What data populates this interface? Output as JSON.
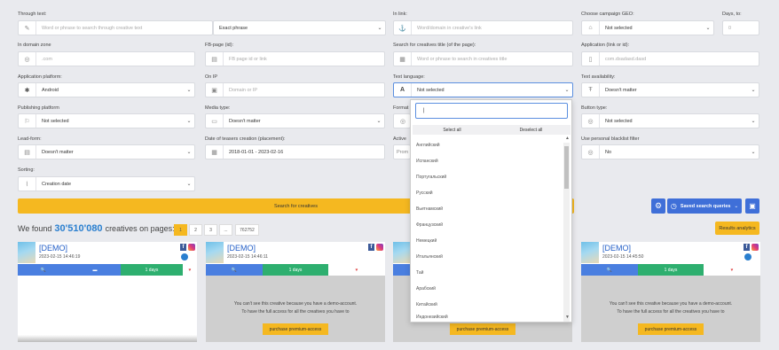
{
  "filters": {
    "through_text": {
      "label": "Through text:",
      "placeholder": "Word or phrase to search through creative text",
      "mode": "Exact phrase"
    },
    "in_link": {
      "label": "In link:",
      "placeholder": "Word/domain in creative's link"
    },
    "campaign_geo": {
      "label": "Choose campaign GEO:",
      "value": "Not selected"
    },
    "days_to": {
      "label": "Days, to:",
      "value": "0"
    },
    "domain_zone": {
      "label": "In domain zone",
      "placeholder": ".com"
    },
    "fb_page": {
      "label": "FB-page (id):",
      "placeholder": "FB page id or link"
    },
    "creative_title": {
      "label": "Search for creatives title (of the page):",
      "placeholder": "Word or phrase to search in creatives title"
    },
    "application": {
      "label": "Application (link or id):",
      "placeholder": "com.dsadasd.dasd"
    },
    "app_platform": {
      "label": "Application platform:",
      "value": "Android"
    },
    "on_ip": {
      "label": "On IP",
      "placeholder": "Domain or IP"
    },
    "text_language": {
      "label": "Text language:",
      "value": "Not selected"
    },
    "text_availability": {
      "label": "Text availability:",
      "value": "Doesn't matter"
    },
    "publishing_platform": {
      "label": "Publishing platform",
      "value": "Not selected"
    },
    "media_type": {
      "label": "Media type:",
      "value": "Doesn't matter"
    },
    "format": {
      "label": "Format"
    },
    "button_type": {
      "label": "Button type:",
      "value": "Not selected"
    },
    "lead_form": {
      "label": "Lead-form:",
      "value": "Doesn't matter"
    },
    "teaser_date": {
      "label": "Date of teasers creation (placement):",
      "value": "2018-01-01 - 2023-02-16"
    },
    "active": {
      "label": "Active",
      "value": "Prom"
    },
    "blacklist": {
      "label": "Use personal blacklist filter",
      "value": "No"
    },
    "sorting": {
      "label": "Sorting:",
      "value": "Creation date"
    }
  },
  "buttons": {
    "search": "Search for creatives",
    "saved_queries": "Saved search queries",
    "results_analytics": "Results analytics"
  },
  "results": {
    "prefix": "We found",
    "count": "30'510'080",
    "suffix": "creatives on pages:",
    "pages": [
      "1",
      "2",
      "3",
      "...",
      "762752"
    ]
  },
  "language_dropdown": {
    "search_value": "|",
    "select_all": "Select all",
    "deselect_all": "Deselect all",
    "options": [
      "Английский",
      "Испанский",
      "Португальский",
      "Русский",
      "Вьетнамский",
      "Французский",
      "Немецкий",
      "Итальянский",
      "Тай",
      "Арабский",
      "Китайский",
      "Индонезийский"
    ]
  },
  "cards": [
    {
      "title": "[DEMO]",
      "date": "2023-02-15 14:46:19",
      "days": "1 days",
      "locked": false
    },
    {
      "title": "[DEMO]",
      "date": "2023-02-15 14:46:11",
      "days": "1 days",
      "locked": true
    },
    {
      "title": "[DEMO]",
      "date": "",
      "days": "",
      "locked": true
    },
    {
      "title": "[DEMO]",
      "date": "2023-02-15 14:45:50",
      "days": "1 days",
      "locked": true
    }
  ],
  "locked_message": {
    "line1": "You can't see this creative because you have a demo-account.",
    "line2": "To have the full access for all the creatives you have to",
    "button": "purchase premium-access"
  },
  "colors": {
    "accent": "#3f6fd8",
    "cta": "#f5b820",
    "green": "#2eaf6f",
    "search_blue": "#4a7fe0",
    "fav": "#e05050"
  }
}
